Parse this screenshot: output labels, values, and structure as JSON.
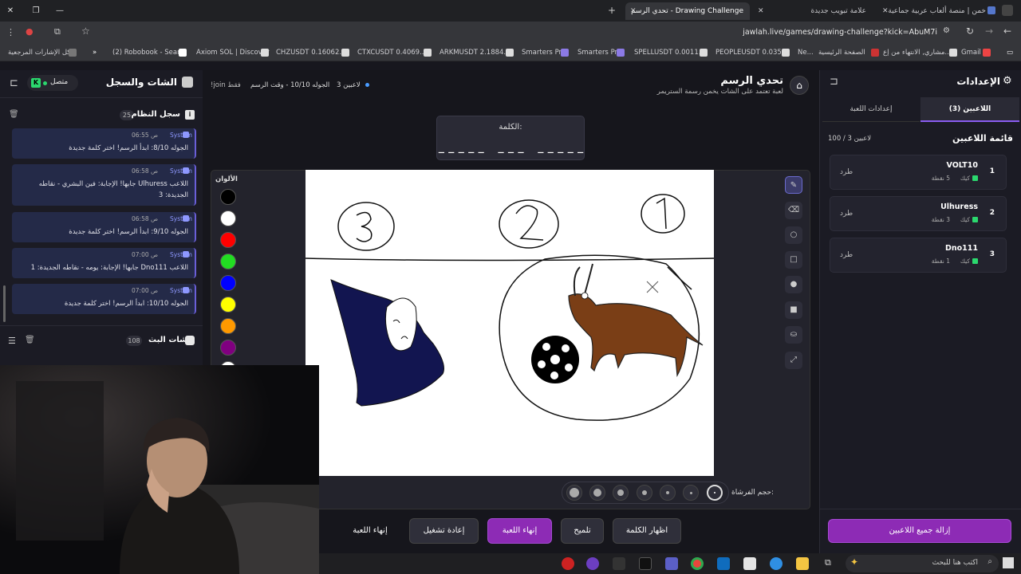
{
  "browser": {
    "tabs": [
      {
        "title": "خمن | منصة ألعاب عربية جماعية"
      },
      {
        "title": "علامة تبويب جديدة"
      },
      {
        "title": "تحدي الرسم - Drawing Challenge"
      }
    ],
    "url": "jawlah.live/games/drawing-challenge?kick=AbuM7i",
    "bookmarks": [
      "كل الإشارات المرجعية",
      "(2) Robobook - Sear...",
      "Axiom SOL | Discover",
      "CHZUSDT 0.16062...",
      "CTXCUSDT 0.4069...",
      "ARKMUSDT 2.1884...",
      "Smarters Pro",
      "Smarters Pro",
      "SPELLUSDT 0.0011...",
      "PEOPLEUSDT 0.035...",
      "Ne...",
      "الصفحة الرئيسية",
      "مشاري, الانتهاء من إع...",
      "Gmail"
    ]
  },
  "left_panel": {
    "title": "الشات والسجل",
    "status": "متصل",
    "system_log": {
      "title": "سجل النظام",
      "count": "25",
      "messages": [
        {
          "name": "System",
          "time": "06:55 ص",
          "text": "الجوله 8/10: ابدأ الرسم! اختر كلمة جديدة"
        },
        {
          "name": "System",
          "time": "06:58 ص",
          "text": "اللاعب Ulhuress جابها! الإجابة: فين البشري - نقاطه الجديدة: 3"
        },
        {
          "name": "System",
          "time": "06:58 ص",
          "text": "الجوله 9/10: ابدأ الرسم! اختر كلمة جديدة"
        },
        {
          "name": "System",
          "time": "07:00 ص",
          "text": "اللاعب Dno111 جابها! الإجابة: يومه - نقاطه الجديدة: 1"
        },
        {
          "name": "System",
          "time": "07:00 ص",
          "text": "الجوله 10/10: ابدأ الرسم! اختر كلمة جديدة"
        }
      ]
    },
    "stream_chat": {
      "title": "شات البث",
      "count": "108"
    }
  },
  "game": {
    "title": "تحدي الرسم",
    "subtitle": "لعبة تعتمد على الشات يخمن رسمة الستريمر",
    "players_count": "3 لاعبين",
    "round_info": "الجوله 10/10 - وقت الرسم",
    "join_hint": "!join فقط",
    "word_label": "الكلمة:",
    "word_mask": "_ _ _ _ _   _ _ _   _ _ _ _ _",
    "colors_label": "الألوان",
    "colors": [
      "#000000",
      "#ffffff",
      "#ff0000",
      "#22dd22",
      "#0000ff",
      "#ffff00",
      "#ff9900",
      "#800080",
      "#ffffff"
    ],
    "brush_label": "حجم الفرشاة:",
    "buttons": {
      "show_word": "اظهار الكلمة",
      "hint": "تلميح",
      "end_game": "إنهاء اللعبة",
      "restart": "إعادة تشغيل",
      "end_game2": "إنهاء اللعبة"
    }
  },
  "right_panel": {
    "title": "الإعدادات",
    "tabs": {
      "players": "اللاعبين (3)",
      "game_settings": "إعدادات اللعبة"
    },
    "list_title": "قائمة اللاعبين",
    "list_count": "100 / 3 لاعبين",
    "players": [
      {
        "rank": "1",
        "name": "VOLT10",
        "points": "5 نقطة",
        "platform": "كيك",
        "kick": "طرد"
      },
      {
        "rank": "2",
        "name": "Ulhuress",
        "points": "3 نقطة",
        "platform": "كيك",
        "kick": "طرد"
      },
      {
        "rank": "3",
        "name": "Dno111",
        "points": "1 نقطة",
        "platform": "كيك",
        "kick": "طرد"
      }
    ],
    "remove_all": "إزالة جميع اللاعبين"
  },
  "taskbar": {
    "search_placeholder": "اكتب هنا للبحث"
  }
}
